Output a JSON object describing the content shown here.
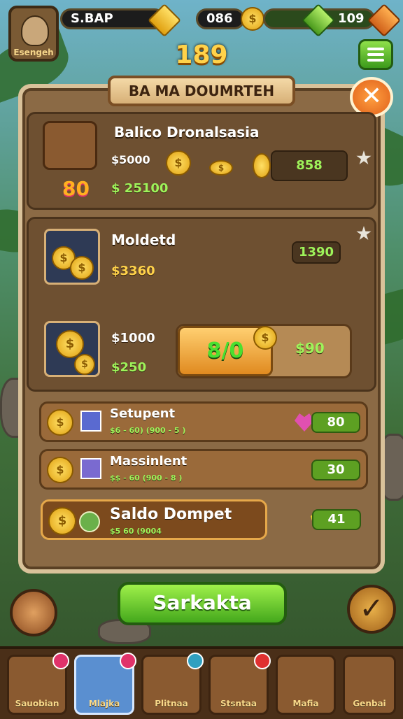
{
  "header": {
    "player_label": "Esengeh",
    "currency1": "S.BAP",
    "currency2": "086",
    "currency3": "109",
    "score": "189"
  },
  "dialog": {
    "title": "BA MA DOUMRTEH",
    "close_symbol": "✕"
  },
  "offer_top": {
    "title": "Balico Dronalsasia",
    "price_label": "$5000",
    "bonus": "80",
    "bonus_value": "$ 25100",
    "right_value": "858"
  },
  "offer_middle": {
    "title": "Moldetd",
    "value": "$3360",
    "right_value": "1390",
    "price2": "$1000",
    "price2_green": "$250",
    "button_text": "8/0",
    "button_right": "$90"
  },
  "rows": [
    {
      "title": "Setupent",
      "subtitle": "$6 - 60) (900 - 5 )",
      "value": "80"
    },
    {
      "title": "Massinlent",
      "subtitle": "$$ - 60 (900 - 8 )",
      "value": "30"
    },
    {
      "title": "Saldo Dompet",
      "subtitle": "$5 60 (9004",
      "value": "41"
    }
  ],
  "action": {
    "primary_label": "Sarkakta"
  },
  "bottom_nav": [
    {
      "label": "Sauobian"
    },
    {
      "label": "Mlajka"
    },
    {
      "label": "Plitnaa"
    },
    {
      "label": "Stsntaa"
    },
    {
      "label": "Mafia"
    },
    {
      "label": "Genbai"
    }
  ],
  "colors": {
    "panel": "#8b6a45",
    "accent_green": "#5da022",
    "gold": "#ffd24a"
  }
}
